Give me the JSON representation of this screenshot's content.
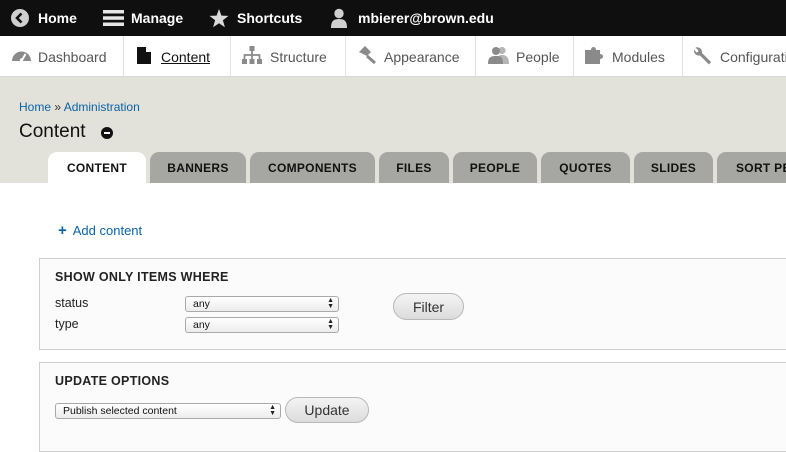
{
  "toolbar": {
    "home_label": "Home",
    "manage_label": "Manage",
    "shortcuts_label": "Shortcuts",
    "user_label": "mbierer@brown.edu"
  },
  "tray": {
    "items": [
      {
        "label": "Dashboard",
        "icon": "dashboard-icon"
      },
      {
        "label": "Content",
        "icon": "content-page-icon",
        "active": true
      },
      {
        "label": "Structure",
        "icon": "structure-icon"
      },
      {
        "label": "Appearance",
        "icon": "appearance-icon"
      },
      {
        "label": "People",
        "icon": "people-icon"
      },
      {
        "label": "Modules",
        "icon": "modules-puzzle-icon"
      },
      {
        "label": "Configurati",
        "icon": "wrench-icon"
      }
    ]
  },
  "breadcrumb": {
    "home": "Home",
    "separator": "»",
    "admin": "Administration"
  },
  "page": {
    "title": "Content"
  },
  "tabs": [
    "CONTENT",
    "BANNERS",
    "COMPONENTS",
    "FILES",
    "PEOPLE",
    "QUOTES",
    "SLIDES",
    "SORT PE"
  ],
  "actions": {
    "add_content": "Add content",
    "add_icon": "plus-icon"
  },
  "filter": {
    "legend": "SHOW ONLY ITEMS WHERE",
    "status_label": "status",
    "status_value": "any",
    "type_label": "type",
    "type_value": "any",
    "button_label": "Filter"
  },
  "update": {
    "legend": "UPDATE OPTIONS",
    "operation_value": "Publish selected content",
    "button_label": "Update"
  },
  "colors": {
    "toolbar_bg": "#0f0f0f",
    "header_bg": "#e2e1da",
    "tab_bg": "#a6a6a2",
    "link": "#0a63a8"
  }
}
